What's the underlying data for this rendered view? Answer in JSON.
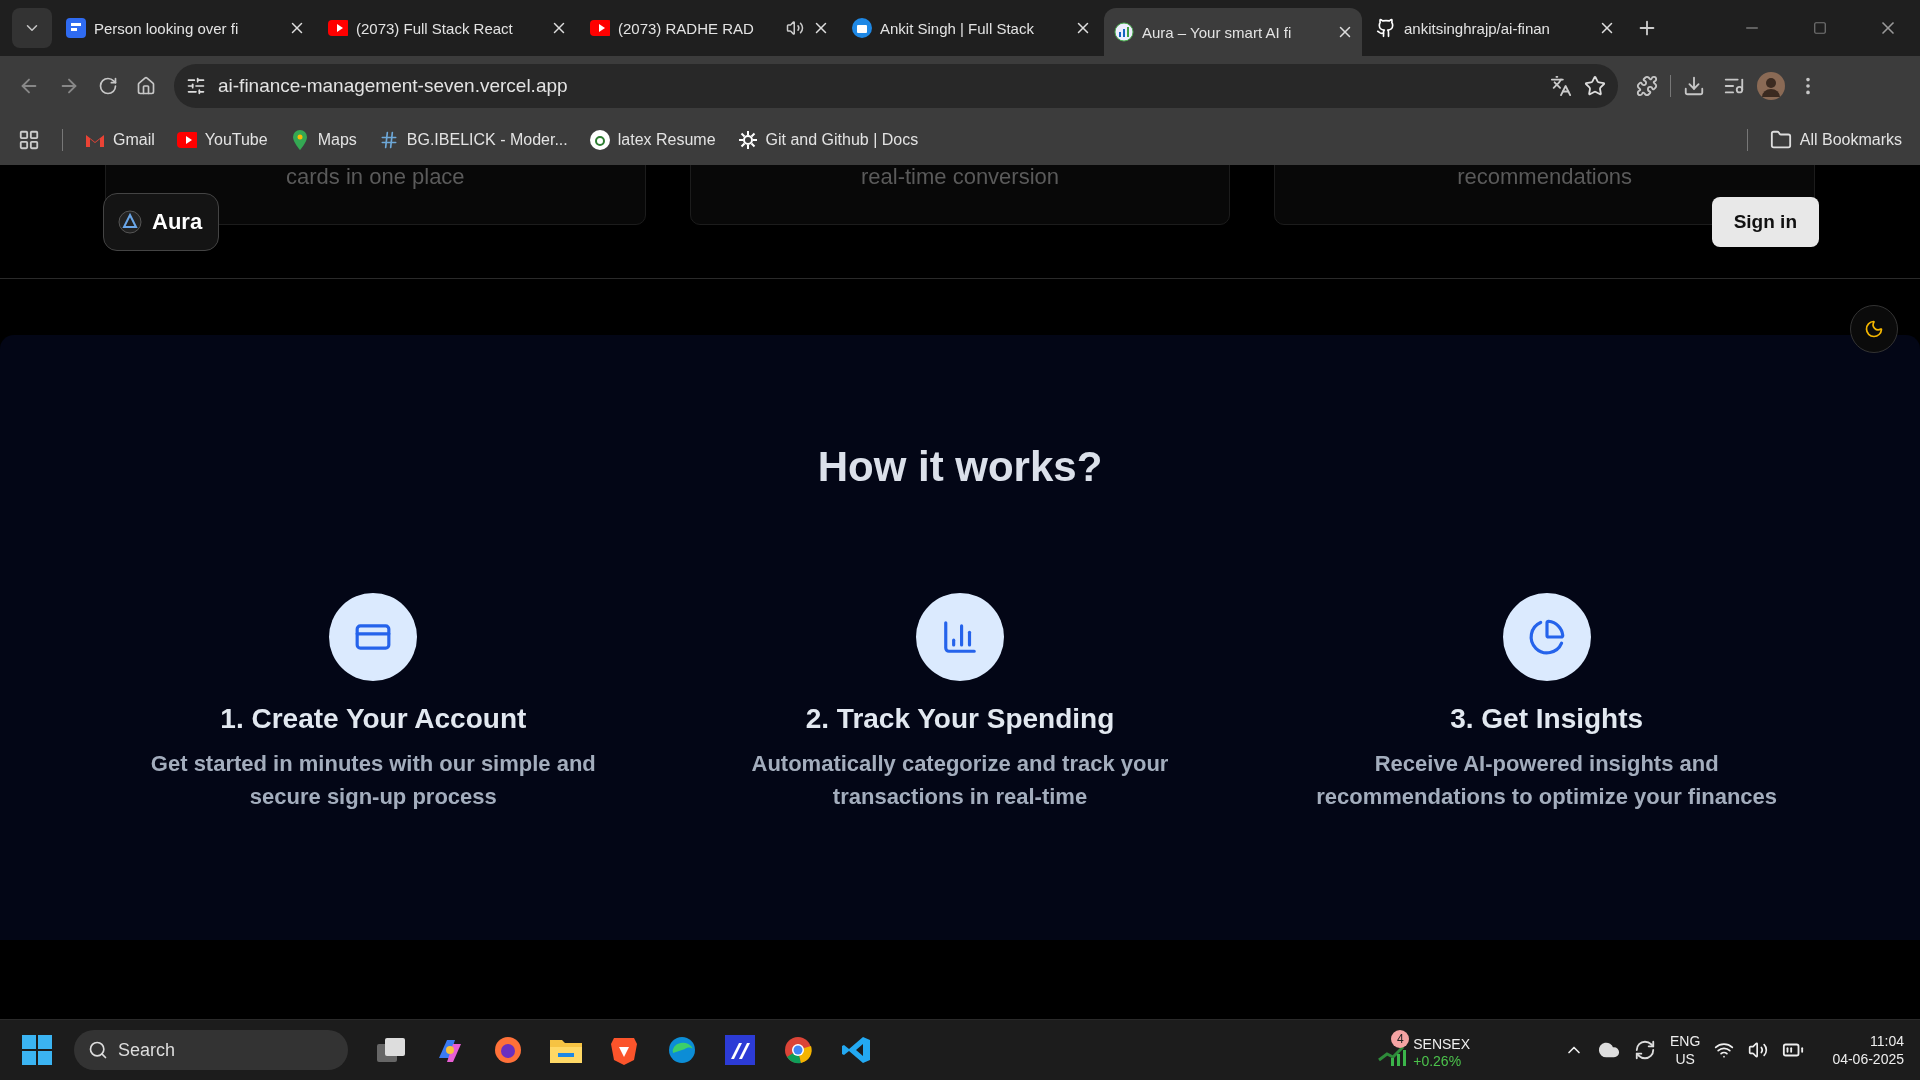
{
  "browser": {
    "tabs": [
      {
        "title": "Person looking over fi",
        "selected": false,
        "audio": false
      },
      {
        "title": "(2073) Full Stack React",
        "selected": false,
        "audio": false
      },
      {
        "title": "(2073) RADHE RAD",
        "selected": false,
        "audio": true
      },
      {
        "title": "Ankit Singh | Full Stack",
        "selected": false,
        "audio": false
      },
      {
        "title": "Aura – Your smart AI fi",
        "selected": true,
        "audio": false
      },
      {
        "title": "ankitsinghrajp/ai-finan",
        "selected": false,
        "audio": false
      }
    ],
    "url": "ai-finance-management-seven.vercel.app",
    "bookmarks": [
      "Gmail",
      "YouTube",
      "Maps",
      "BG.IBELICK - Moder...",
      "latex Resume",
      "Git and Github | Docs"
    ],
    "all_bookmarks": "All Bookmarks"
  },
  "page": {
    "behind_cards": [
      "cards in one place",
      "real-time conversion",
      "recommendations"
    ],
    "brand": "Aura",
    "sign_in": "Sign in",
    "section_title": "How it works?",
    "steps": [
      {
        "title": "1. Create Your Account",
        "text": "Get started in minutes with our simple and secure sign-up process"
      },
      {
        "title": "2. Track Your Spending",
        "text": "Automatically categorize and track your transactions in real-time"
      },
      {
        "title": "3. Get Insights",
        "text": "Receive AI-powered insights and recommendations to optimize your finances"
      }
    ]
  },
  "taskbar": {
    "search": "Search",
    "ticker": {
      "badge": "4",
      "name": "SENSEX",
      "change": "+0.26%"
    },
    "lang": "ENG",
    "region": "US",
    "time": "11:04",
    "date": "04-06-2025"
  }
}
